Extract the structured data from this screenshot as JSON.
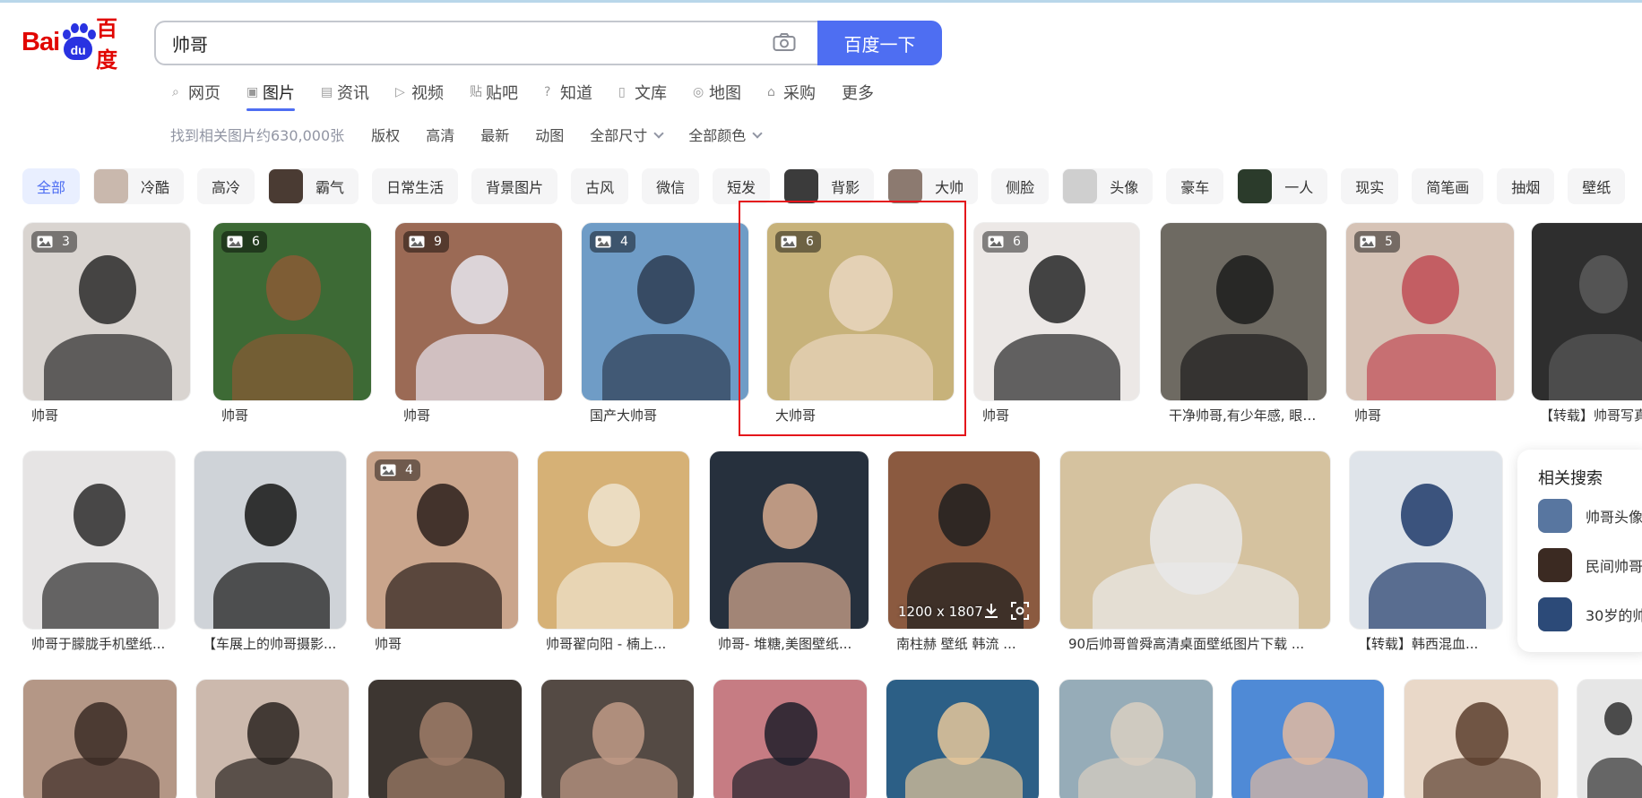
{
  "logo": {
    "bai": "Bai",
    "du": "du",
    "cn": "百度"
  },
  "search": {
    "query": "帅哥",
    "button_label": "百度一下"
  },
  "nav": [
    {
      "label": "网页",
      "icon": "search-icon"
    },
    {
      "label": "图片",
      "icon": "image-icon",
      "active": true
    },
    {
      "label": "资讯",
      "icon": "news-icon"
    },
    {
      "label": "视频",
      "icon": "video-icon"
    },
    {
      "label": "贴吧",
      "icon": "tieba-icon"
    },
    {
      "label": "知道",
      "icon": "question-icon"
    },
    {
      "label": "文库",
      "icon": "doc-icon"
    },
    {
      "label": "地图",
      "icon": "map-icon"
    },
    {
      "label": "采购",
      "icon": "cart-icon"
    },
    {
      "label": "更多",
      "icon": ""
    }
  ],
  "filters": {
    "count_text": "找到相关图片约630,000张",
    "items": [
      "版权",
      "高清",
      "最新",
      "动图"
    ],
    "dropdowns": [
      "全部尺寸",
      "全部颜色"
    ]
  },
  "tags": [
    {
      "label": "全部",
      "active": true
    },
    {
      "label": "冷酷",
      "thumb": true
    },
    {
      "label": "高冷"
    },
    {
      "label": "霸气",
      "thumb": true
    },
    {
      "label": "日常生活"
    },
    {
      "label": "背景图片"
    },
    {
      "label": "古风"
    },
    {
      "label": "微信"
    },
    {
      "label": "短发"
    },
    {
      "label": "背影",
      "thumb": true
    },
    {
      "label": "大帅",
      "thumb": true
    },
    {
      "label": "侧脸"
    },
    {
      "label": "头像",
      "thumb": true
    },
    {
      "label": "豪车"
    },
    {
      "label": "一人",
      "thumb": true
    },
    {
      "label": "现实"
    },
    {
      "label": "简笔画"
    },
    {
      "label": "抽烟"
    },
    {
      "label": "壁纸"
    }
  ],
  "row1": [
    {
      "caption": "帅哥",
      "badge": "3",
      "bg": "#d9d4d0",
      "fg": "#2a2a2a"
    },
    {
      "caption": "帅哥",
      "badge": "6",
      "bg": "#3d6a35",
      "fg": "#8a5a35"
    },
    {
      "caption": "帅哥",
      "badge": "9",
      "bg": "#9b6a55",
      "fg": "#e8e6f0"
    },
    {
      "caption": "国产大帅哥",
      "badge": "4",
      "bg": "#6f9cc6",
      "fg": "#2e3d52"
    },
    {
      "caption": "大帅哥",
      "badge": "6",
      "bg": "#c7b27a",
      "fg": "#e9d6bf"
    },
    {
      "caption": "帅哥",
      "badge": "6",
      "bg": "#ece8e6",
      "fg": "#262626"
    },
    {
      "caption": "干净帅哥,有少年感, 眼里...",
      "bg": "#6e6a62",
      "fg": "#1c1c1c"
    },
    {
      "caption": "帅哥",
      "badge": "5",
      "bg": "#d6c3b6",
      "fg": "#c04c55"
    },
    {
      "caption": "【转载】帅哥写真",
      "bg": "#2e2e2e",
      "fg": "#5a5a5a"
    }
  ],
  "row2": [
    {
      "caption": "帅哥于朦胧手机壁纸...",
      "bg": "#e6e4e4",
      "fg": "#2c2c2c"
    },
    {
      "caption": "【车展上的帅哥摄影...",
      "bg": "#cfd3d8",
      "fg": "#151515"
    },
    {
      "caption": "帅哥",
      "badge": "4",
      "bg": "#caa58c",
      "fg": "#2b1f1b"
    },
    {
      "caption": "帅哥翟向阳 - 楠上...",
      "bg": "#d6b176",
      "fg": "#efe4cf"
    },
    {
      "caption": "帅哥- 堆糖,美图壁纸...",
      "bg": "#26303d",
      "fg": "#d7aa8e"
    },
    {
      "caption": "南柱赫 壁纸 韩流 ...",
      "bg": "#8b5a40",
      "fg": "#1e1e1e",
      "dim": "1200 x 1807"
    },
    {
      "caption": "90后帅哥曾舜高清桌面壁纸图片下载 ...",
      "bg": "#d5c29f",
      "fg": "#e9e9e9"
    },
    {
      "caption": "【转载】韩西混血...",
      "bg": "#dfe4ea",
      "fg": "#1f3a6a"
    }
  ],
  "row3": [
    {
      "bg": "#b49786",
      "fg": "#3a2a24"
    },
    {
      "bg": "#ccb9ad",
      "fg": "#2a2320"
    },
    {
      "bg": "#3d3631",
      "fg": "#9f7d68"
    },
    {
      "bg": "#544a44",
      "fg": "#c09a86"
    },
    {
      "bg": "#c67c83",
      "fg": "#1f1f2a"
    },
    {
      "bg": "#2c5f86",
      "fg": "#e6c79a"
    },
    {
      "bg": "#96acb8",
      "fg": "#d9cfc1"
    },
    {
      "bg": "#4f8ad6",
      "fg": "#e0b9a0"
    },
    {
      "bg": "#e9d8c8",
      "fg": "#5a3e2d"
    },
    {
      "bg": "#e6e6e6",
      "fg": "#2f2f2f"
    }
  ],
  "related": {
    "title": "相关搜索",
    "items": [
      {
        "label": "帅哥头像",
        "color": "#5876a0"
      },
      {
        "label": "民间帅哥",
        "color": "#3b2a22"
      },
      {
        "label": "30岁的帅",
        "color": "#2c4a78"
      }
    ]
  }
}
